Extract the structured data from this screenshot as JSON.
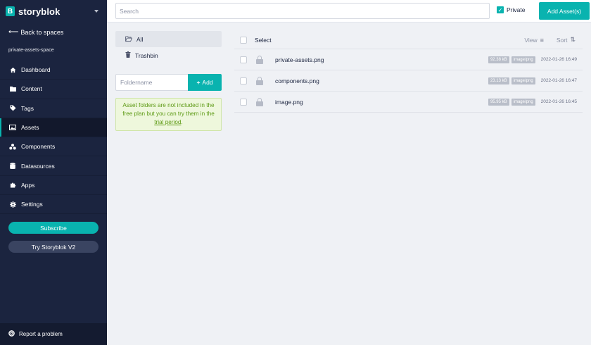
{
  "brand": {
    "name": "storyblok",
    "logo_letter": "B"
  },
  "sidebar": {
    "back_label": "Back to spaces",
    "space_name": "private-assets-space",
    "items": [
      {
        "label": "Dashboard",
        "icon": "home-icon"
      },
      {
        "label": "Content",
        "icon": "folder-icon"
      },
      {
        "label": "Tags",
        "icon": "tag-icon"
      },
      {
        "label": "Assets",
        "icon": "image-icon",
        "active": true
      },
      {
        "label": "Components",
        "icon": "components-icon"
      },
      {
        "label": "Datasources",
        "icon": "database-icon"
      },
      {
        "label": "Apps",
        "icon": "puzzle-icon"
      },
      {
        "label": "Settings",
        "icon": "gear-icon"
      }
    ],
    "subscribe_label": "Subscribe",
    "try_v2_label": "Try Storyblok V2",
    "report_label": "Report a problem"
  },
  "topbar": {
    "search_placeholder": "Search",
    "private_label": "Private",
    "private_checked": true,
    "add_asset_label": "Add Asset(s)"
  },
  "folders": {
    "all_label": "All",
    "trash_label": "Trashbin",
    "foldername_placeholder": "Foldername",
    "add_label": "Add",
    "notice_text": "Asset folders are not included in the free plan but you can try them in the",
    "notice_link": "trial period",
    "notice_end": "."
  },
  "list": {
    "select_label": "Select",
    "view_label": "View",
    "sort_label": "Sort",
    "assets": [
      {
        "name": "private-assets.png",
        "size": "92.38 kB",
        "type": "image/png",
        "date": "2022-01-26 16:49"
      },
      {
        "name": "components.png",
        "size": "23.13 kB",
        "type": "image/png",
        "date": "2022-01-26 16:47"
      },
      {
        "name": "image.png",
        "size": "95.95 kB",
        "type": "image/png",
        "date": "2022-01-26 16:45"
      }
    ]
  },
  "colors": {
    "accent": "#09b3af",
    "sidebar_bg": "#1b243f",
    "page_bg": "#eff1f5"
  }
}
